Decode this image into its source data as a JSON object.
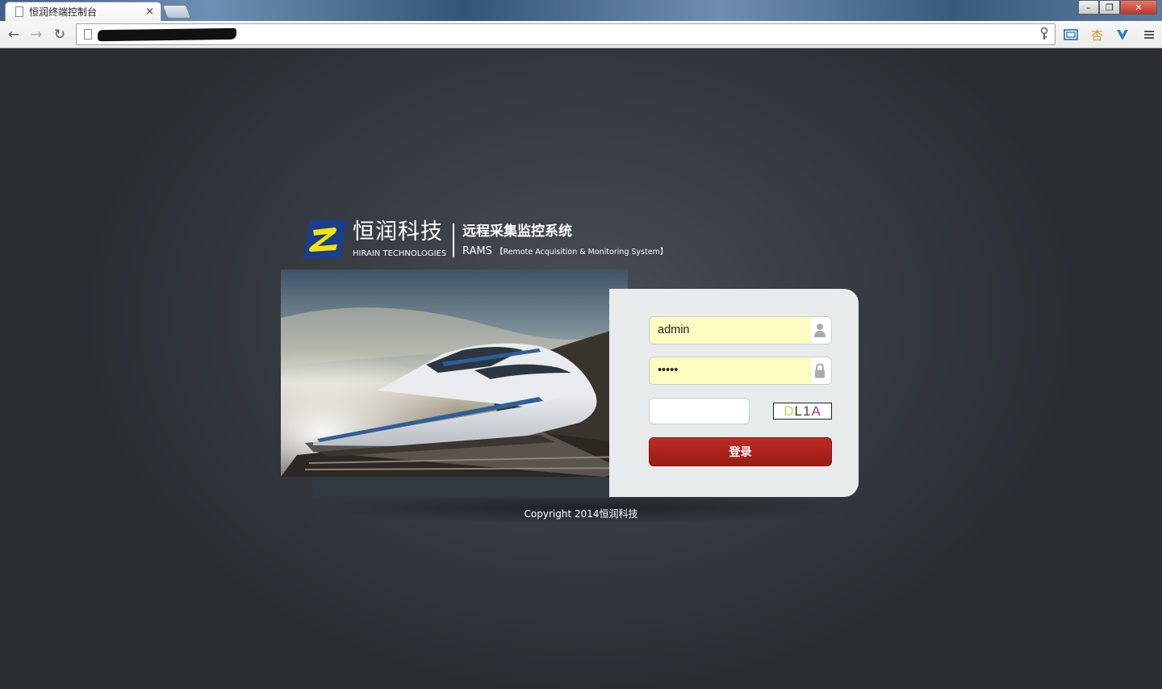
{
  "browser": {
    "tab_title": "恒润终端控制台",
    "tab_close": "×",
    "window_controls": {
      "minimize": "–",
      "maximize": "❐",
      "close": "✕"
    },
    "nav": {
      "back": "←",
      "forward": "→",
      "reload": "↻"
    },
    "address_bar": {
      "url": ""
    },
    "toolbar_icons": [
      "key-icon",
      "fullscreen-icon",
      "extension-icon",
      "vpn-shield-icon",
      "menu-icon"
    ]
  },
  "brand": {
    "company_cn": "恒润科技",
    "company_en": "HIRAIN TECHNOLOGIES",
    "system_cn": "远程采集监控系统",
    "system_abbr": "RAMS",
    "system_en": "【Remote Acquisition & Monitoring System】",
    "logo_colors": {
      "blue": "#1a3e8c",
      "yellow": "#f3e10b"
    }
  },
  "login": {
    "username_value": "admin",
    "password_value": "•••••",
    "captcha_value": "",
    "captcha_chars": [
      {
        "char": "D",
        "color": "#b8d84a"
      },
      {
        "char": "L",
        "color": "#2e3b10"
      },
      {
        "char": "1",
        "color": "#4a4a4a"
      },
      {
        "char": "A",
        "color": "#a33c9e"
      }
    ],
    "submit_label": "登录",
    "accent_color": "#ab231b"
  },
  "footer": {
    "copyright": "Copyright 2014恒润科技"
  }
}
